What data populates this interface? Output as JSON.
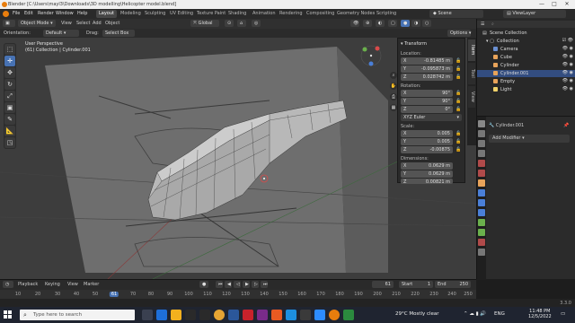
{
  "window": {
    "title": "Blender [C:\\Users\\mayl3\\Downloads\\3D modelling\\Helicopter model.blend]",
    "controls": [
      "—",
      "□",
      "✕"
    ]
  },
  "menubar": {
    "menus": [
      "File",
      "Edit",
      "Render",
      "Window",
      "Help"
    ],
    "workspaces": [
      "Layout",
      "Modeling",
      "Sculpting",
      "UV Editing",
      "Texture Paint",
      "Shading",
      "Animation",
      "Rendering",
      "Compositing",
      "Geometry Nodes",
      "Scripting"
    ],
    "active_workspace": "Layout",
    "scene": "Scene",
    "view_layer": "ViewLayer"
  },
  "viewport_header": {
    "mode": "Object Mode",
    "menus": [
      "View",
      "Select",
      "Add",
      "Object"
    ],
    "orientation_label": "Orientation:",
    "orientation": "Default",
    "drag_label": "Drag:",
    "drag": "Select Box",
    "transform_orientation": "Global",
    "options": "Options"
  },
  "viewport": {
    "view_name": "User Perspective",
    "collection_path": "(61) Collection | Cylinder.001"
  },
  "npanel": {
    "header": "Transform",
    "location_label": "Location:",
    "location": [
      {
        "axis": "X",
        "value": "-0.81485 m"
      },
      {
        "axis": "Y",
        "value": "-0.095873 m"
      },
      {
        "axis": "Z",
        "value": "0.028742 m"
      }
    ],
    "rotation_label": "Rotation:",
    "rotation": [
      {
        "axis": "X",
        "value": "90°"
      },
      {
        "axis": "Y",
        "value": "90°"
      },
      {
        "axis": "Z",
        "value": "0°"
      }
    ],
    "rotation_mode": "XYZ Euler",
    "scale_label": "Scale:",
    "scale": [
      {
        "axis": "X",
        "value": "0.005"
      },
      {
        "axis": "Y",
        "value": "0.005"
      },
      {
        "axis": "Z",
        "value": "-0.00875"
      }
    ],
    "dimensions_label": "Dimensions:",
    "dimensions": [
      {
        "axis": "X",
        "value": "0.0629 m"
      },
      {
        "axis": "Y",
        "value": "0.0629 m"
      },
      {
        "axis": "Z",
        "value": "0.00821 m"
      }
    ],
    "tabs": [
      "Item",
      "Tool",
      "View"
    ]
  },
  "outliner": {
    "header": "Scene Collection",
    "collection": "Collection",
    "items": [
      {
        "name": "Camera",
        "color": "#6a8fd1"
      },
      {
        "name": "Cube",
        "color": "#e8a35a"
      },
      {
        "name": "Cylinder",
        "color": "#e8a35a"
      },
      {
        "name": "Cylinder.001",
        "color": "#e8a35a"
      },
      {
        "name": "Empty",
        "color": "#e8a35a"
      },
      {
        "name": "Light",
        "color": "#f0d26a"
      }
    ]
  },
  "properties": {
    "object_name": "Cylinder.001",
    "add_modifier": "Add Modifier"
  },
  "timeline": {
    "menus": [
      "Playback",
      "Keying",
      "View",
      "Marker"
    ],
    "ticks": [
      "10",
      "20",
      "30",
      "40",
      "50",
      "61",
      "70",
      "80",
      "90",
      "100",
      "110",
      "120",
      "130",
      "140",
      "150",
      "160",
      "170",
      "180",
      "190",
      "200",
      "210",
      "220",
      "230",
      "240",
      "250"
    ],
    "current_frame": "61",
    "start_label": "Start",
    "start": "1",
    "end_label": "End",
    "end": "250"
  },
  "statusbar": {
    "version": "3.3.0"
  },
  "taskbar": {
    "search_placeholder": "Type here to search",
    "weather": "29°C  Mostly clear",
    "time": "11:48 PM",
    "date": "12/5/2022",
    "lang": "ENG"
  },
  "colors": {
    "accent": "#4772b3",
    "blender_orange": "#e87d0d"
  }
}
